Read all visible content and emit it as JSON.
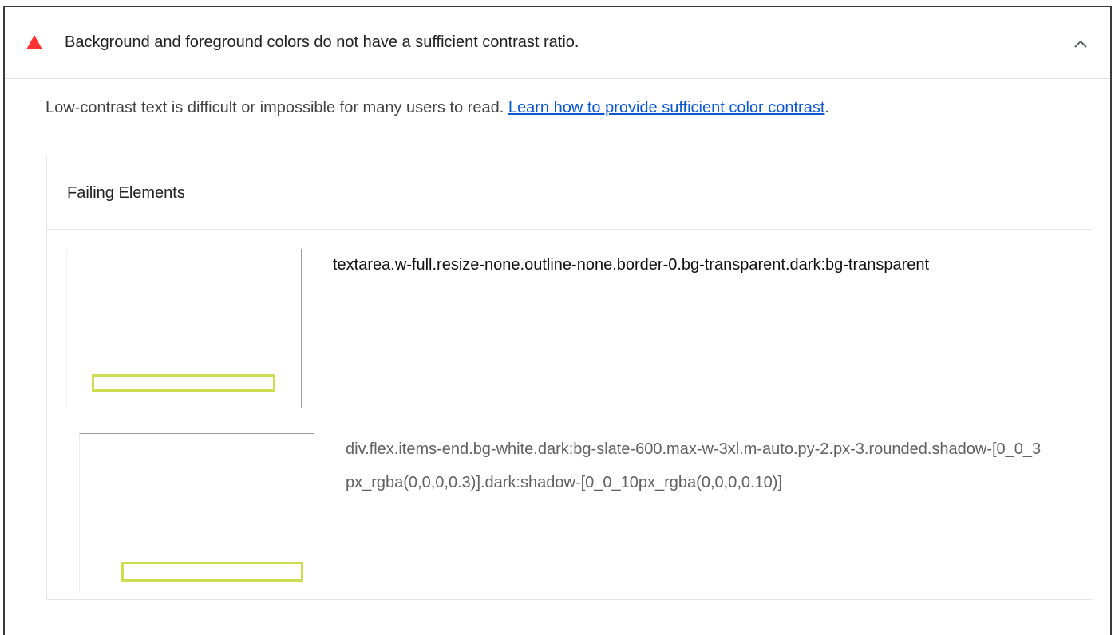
{
  "audit": {
    "title": "Background and foreground colors do not have a sufficient contrast ratio.",
    "status_icon": "fail-triangle-icon",
    "status_color": "#f33",
    "expand_icon": "chevron-up-icon"
  },
  "description": {
    "text": "Low-contrast text is difficult or impossible for many users to read. ",
    "link_text": "Learn how to provide sufficient color contrast",
    "trailing": "."
  },
  "table": {
    "header": "Failing Elements",
    "rows": [
      {
        "selector": "textarea.w-full.resize-none.outline-none.border-0.bg-transparent.dark:bg-transparent"
      },
      {
        "selector": "div.flex.items-end.bg-white.dark:bg-slate-600.max-w-3xl.m-auto.py-2.px-3.rounded.shadow-[0_0_3px_rgba(0,0,0,0.3)].dark:shadow-[0_0_10px_rgba(0,0,0,0.10)]"
      }
    ]
  },
  "colors": {
    "highlight": "#cddc50",
    "link": "#0b57d0"
  }
}
